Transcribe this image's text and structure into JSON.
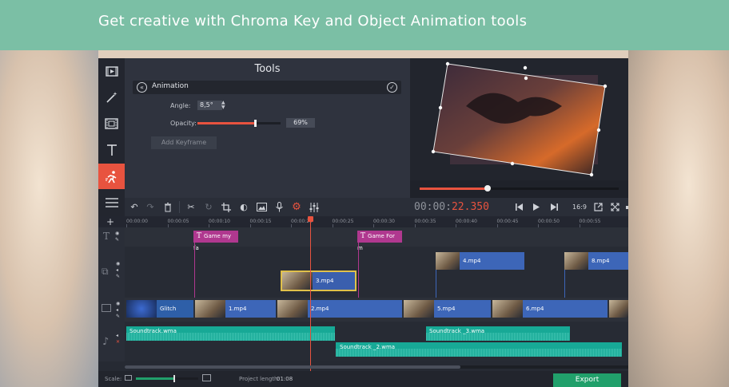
{
  "banner": {
    "title": "Get creative with Chroma Key and Object Animation tools"
  },
  "sidebar": {
    "icons": [
      "film-icon",
      "magic-wand-icon",
      "filter-icon",
      "text-icon",
      "animation-icon",
      "menu-icon"
    ]
  },
  "tools": {
    "title": "Tools",
    "section": "Animation",
    "angle_label": "Angle:",
    "angle_value": "8,5°",
    "opacity_label": "Opacity:",
    "opacity_value": "69%",
    "opacity_fraction": 0.69,
    "add_keyframe_label": "Add Keyframe"
  },
  "player": {
    "progress_fraction": 0.34,
    "timecode_gray": "00:00:",
    "timecode_red": "22.350",
    "aspect_label": "16:9"
  },
  "timeline": {
    "ruler": [
      "00:00:00",
      "00:00:05",
      "00:00:10",
      "00:00:15",
      "00:00:20",
      "00:00:25",
      "00:00:30",
      "00:00:35",
      "00:00:40",
      "00:00:45",
      "00:00:50",
      "00:00:55"
    ],
    "title_clips": [
      {
        "label": "Game my fa"
      },
      {
        "label": "Game For m"
      }
    ],
    "overlay_clips": [
      {
        "label": "4.mp4"
      },
      {
        "label": "3.mp4"
      },
      {
        "label": "8.mp4"
      }
    ],
    "video_clips": [
      {
        "label": "Glitch"
      },
      {
        "label": "1.mp4"
      },
      {
        "label": "2.mp4"
      },
      {
        "label": "5.mp4"
      },
      {
        "label": "6.mp4"
      }
    ],
    "audio_clips": [
      {
        "label": "Soundtrack.wma"
      },
      {
        "label": "Soundtrack _3.wma"
      },
      {
        "label": "Soundtrack _2.wma"
      }
    ]
  },
  "status": {
    "scale_label": "Scale:",
    "project_length_label": "Project length:",
    "project_length_value": "01:08",
    "export_label": "Export"
  }
}
